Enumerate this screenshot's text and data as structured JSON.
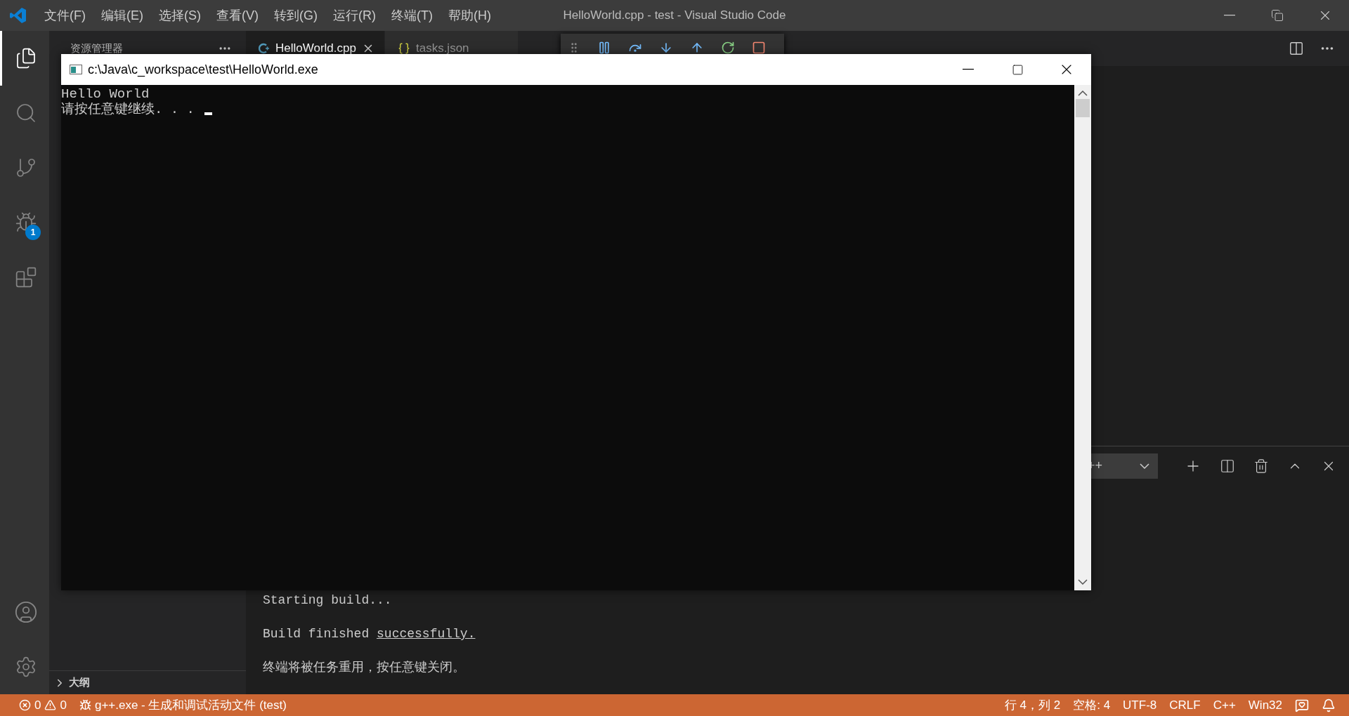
{
  "window": {
    "title": "HelloWorld.cpp - test - Visual Studio Code"
  },
  "menu": [
    "文件(F)",
    "编辑(E)",
    "选择(S)",
    "查看(V)",
    "转到(G)",
    "运行(R)",
    "终端(T)",
    "帮助(H)"
  ],
  "activity_bar": [
    {
      "kind": "files",
      "selected": true
    },
    {
      "kind": "search",
      "selected": false
    },
    {
      "kind": "scm",
      "selected": false
    },
    {
      "kind": "debug",
      "selected": false,
      "badge": "1"
    },
    {
      "kind": "extensions",
      "selected": false
    }
  ],
  "sidebar": {
    "title": "资源管理器",
    "outline": {
      "label": "大纲",
      "expanded": false
    }
  },
  "tabs": [
    {
      "label": "HelloWorld.cpp",
      "kind": "cpp",
      "selected": true
    },
    {
      "label": "tasks.json",
      "kind": "json",
      "selected": false
    }
  ],
  "console_window": {
    "title": "c:\\Java\\c_workspace\\test\\HelloWorld.exe",
    "lines": [
      "Hello World",
      "请按任意键继续. . ."
    ]
  },
  "terminal": {
    "dropdown": "++",
    "lines": [
      {
        "text": "Starting build..."
      },
      {
        "text": "Build finished ",
        "link": "successfully."
      },
      {
        "text": "终端将被任务重用，按任意键关闭。"
      }
    ]
  },
  "status_bar": {
    "errors": "0",
    "warnings": "0",
    "task": "g++.exe - 生成和调试活动文件 (test)",
    "items": [
      "行 4，列 2",
      "空格: 4",
      "UTF-8",
      "CRLF",
      "C++",
      "Win32"
    ]
  }
}
